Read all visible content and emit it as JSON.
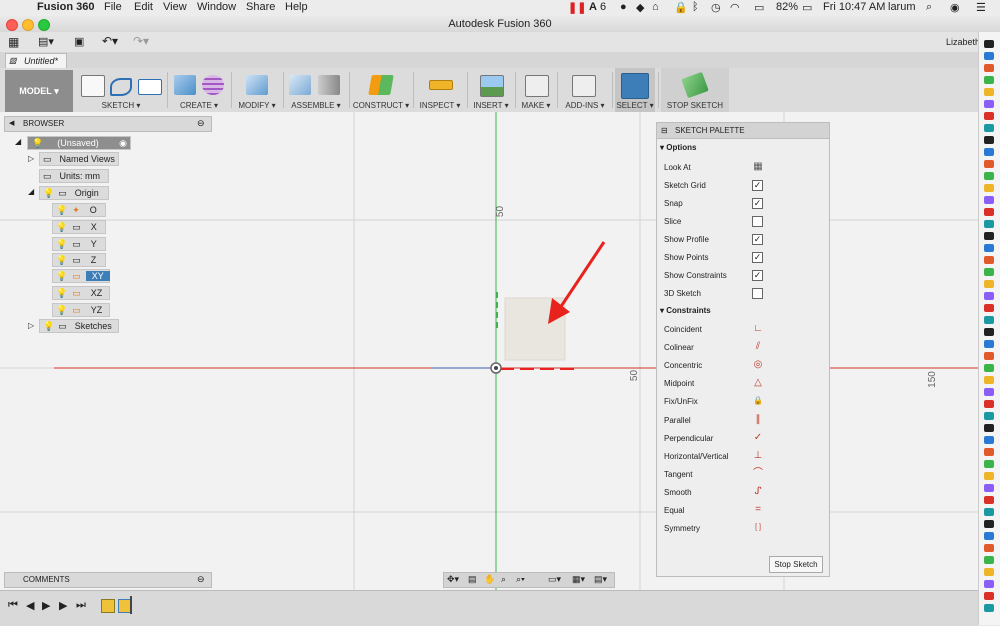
{
  "menubar": {
    "app": "Fusion 360",
    "items": [
      "File",
      "Edit",
      "View",
      "Window",
      "Share",
      "Help"
    ],
    "adobe_count": "6",
    "battery": "82%",
    "clock": "Fri 10:47 AM",
    "user": "larum"
  },
  "window": {
    "title": "Autodesk Fusion 360"
  },
  "qat": {
    "user": "Lizabeth"
  },
  "tab": {
    "name": "Untitled*"
  },
  "ribbon": {
    "workspace": "MODEL",
    "groups": {
      "sketch": "SKETCH",
      "create": "CREATE",
      "modify": "MODIFY",
      "assemble": "ASSEMBLE",
      "construct": "CONSTRUCT",
      "inspect": "INSPECT",
      "insert": "INSERT",
      "make": "MAKE",
      "addins": "ADD-INS",
      "select": "SELECT",
      "stop": "STOP SKETCH"
    }
  },
  "browser": {
    "title": "BROWSER",
    "root": "(Unsaved)",
    "named_views": "Named Views",
    "units": "Units: mm",
    "origin": "Origin",
    "origin_items": [
      "O",
      "X",
      "Y",
      "Z",
      "XY",
      "XZ",
      "YZ"
    ],
    "sketches": "Sketches"
  },
  "canvas": {
    "dim_top": "50",
    "dim_right": "50",
    "dim_far": "150"
  },
  "palette": {
    "title": "SKETCH PALETTE",
    "options_title": "Options",
    "options": [
      {
        "label": "Look At",
        "checked": null
      },
      {
        "label": "Sketch Grid",
        "checked": true
      },
      {
        "label": "Snap",
        "checked": true
      },
      {
        "label": "Slice",
        "checked": false
      },
      {
        "label": "Show Profile",
        "checked": true
      },
      {
        "label": "Show Points",
        "checked": true
      },
      {
        "label": "Show Constraints",
        "checked": true
      },
      {
        "label": "3D Sketch",
        "checked": false
      }
    ],
    "constraints_title": "Constraints",
    "constraints": [
      {
        "label": "Coincident",
        "icon": "coincident-icon",
        "glyph": "∟"
      },
      {
        "label": "Colinear",
        "icon": "colinear-icon",
        "glyph": "⫽"
      },
      {
        "label": "Concentric",
        "icon": "concentric-icon",
        "glyph": "◎"
      },
      {
        "label": "Midpoint",
        "icon": "midpoint-icon",
        "glyph": "△"
      },
      {
        "label": "Fix/UnFix",
        "icon": "lock-icon",
        "glyph": "🔒"
      },
      {
        "label": "Parallel",
        "icon": "parallel-icon",
        "glyph": "∥"
      },
      {
        "label": "Perpendicular",
        "icon": "perpendicular-icon",
        "glyph": "✓"
      },
      {
        "label": "Horizontal/Vertical",
        "icon": "horizontal-vertical-icon",
        "glyph": "⊥"
      },
      {
        "label": "Tangent",
        "icon": "tangent-icon",
        "glyph": "⌒"
      },
      {
        "label": "Smooth",
        "icon": "smooth-icon",
        "glyph": "ᔑ"
      },
      {
        "label": "Equal",
        "icon": "equal-icon",
        "glyph": "="
      },
      {
        "label": "Symmetry",
        "icon": "symmetry-icon",
        "glyph": "[ ]"
      }
    ],
    "stop_button": "Stop Sketch"
  },
  "comments": {
    "title": "COMMENTS"
  },
  "colors": {
    "accent": "#4a8fc7",
    "select_active": "#3d7eb8",
    "axis_x": "#d9302a",
    "axis_y": "#3bb54a",
    "arrow": "#e8221c"
  }
}
